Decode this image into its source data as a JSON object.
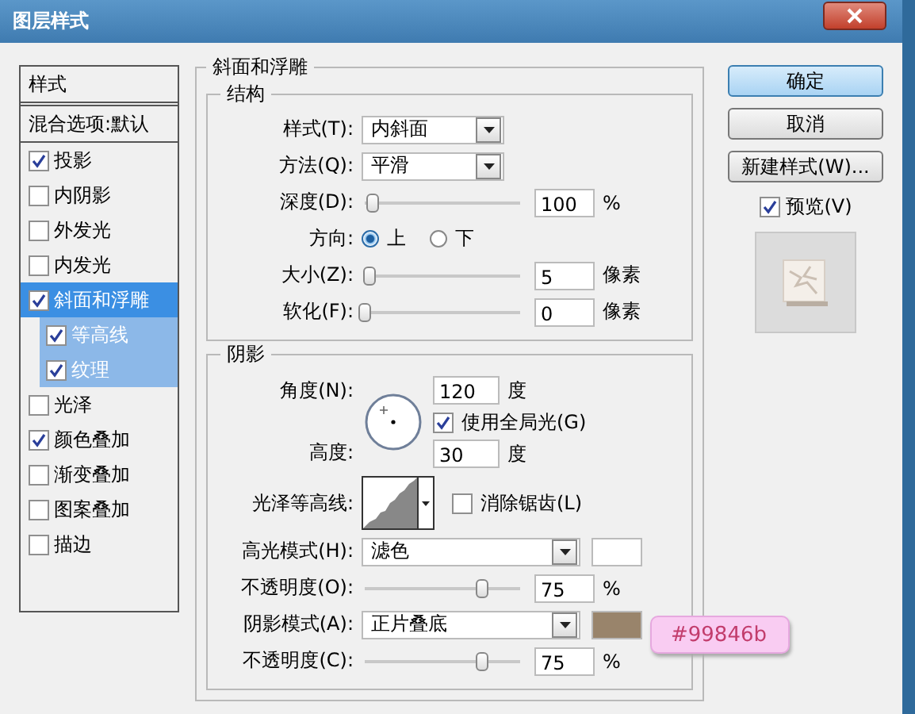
{
  "window": {
    "title": "图层样式"
  },
  "sidebar": {
    "header": "样式",
    "blend_options": "混合选项:默认",
    "items": [
      {
        "label": "投影",
        "checked": true,
        "selected": false
      },
      {
        "label": "内阴影",
        "checked": false,
        "selected": false
      },
      {
        "label": "外发光",
        "checked": false,
        "selected": false
      },
      {
        "label": "内发光",
        "checked": false,
        "selected": false
      },
      {
        "label": "斜面和浮雕",
        "checked": true,
        "selected": true,
        "children": [
          {
            "label": "等高线",
            "checked": true,
            "selected": false
          },
          {
            "label": "纹理",
            "checked": true,
            "selected": false
          }
        ]
      },
      {
        "label": "光泽",
        "checked": false,
        "selected": false
      },
      {
        "label": "颜色叠加",
        "checked": true,
        "selected": false
      },
      {
        "label": "渐变叠加",
        "checked": false,
        "selected": false
      },
      {
        "label": "图案叠加",
        "checked": false,
        "selected": false
      },
      {
        "label": "描边",
        "checked": false,
        "selected": false
      }
    ]
  },
  "panel": {
    "title": "斜面和浮雕",
    "structure": {
      "title": "结构",
      "rows": [
        {
          "kind": "select",
          "label": "样式(T):",
          "value": "内斜面"
        },
        {
          "kind": "select",
          "label": "方法(Q):",
          "value": "平滑"
        },
        {
          "kind": "slider",
          "label": "深度(D):",
          "level": 0.05,
          "value": "100",
          "unit": "%"
        },
        {
          "kind": "radio",
          "label": "方向:",
          "options": [
            {
              "label": "上",
              "selected": true
            },
            {
              "label": "下",
              "selected": false
            }
          ]
        },
        {
          "kind": "slider",
          "label": "大小(Z):",
          "level": 0.03,
          "value": "5",
          "unit": "像素"
        },
        {
          "kind": "slider",
          "label": "软化(F):",
          "level": 0,
          "value": "0",
          "unit": "像素"
        }
      ]
    },
    "shading": {
      "title": "阴影",
      "angle": {
        "label": "角度(N):",
        "value": "120",
        "unit": "度"
      },
      "global_light": {
        "label": "使用全局光(G)",
        "checked": true
      },
      "altitude": {
        "label": "高度:",
        "value": "30",
        "unit": "度"
      },
      "gloss_contour": {
        "label": "光泽等高线:"
      },
      "anti_alias": {
        "label": "消除锯齿(L)",
        "checked": false
      },
      "rows": [
        {
          "kind": "mode",
          "label": "高光模式(H):",
          "value": "滤色",
          "color": "#ffffff"
        },
        {
          "kind": "slider",
          "label": "不透明度(O):",
          "level": 0.75,
          "value": "75",
          "unit": "%"
        },
        {
          "kind": "mode",
          "label": "阴影模式(A):",
          "value": "正片叠底",
          "color": "#99846b"
        },
        {
          "kind": "slider",
          "label": "不透明度(C):",
          "level": 0.75,
          "value": "75",
          "unit": "%"
        }
      ]
    }
  },
  "buttons": [
    {
      "label": "确定",
      "default": true
    },
    {
      "label": "取消",
      "default": false
    },
    {
      "label": "新建样式(W)...",
      "default": false
    }
  ],
  "preview": {
    "label": "预览(V)",
    "checked": true
  },
  "annotation": {
    "text": "#99846b"
  }
}
